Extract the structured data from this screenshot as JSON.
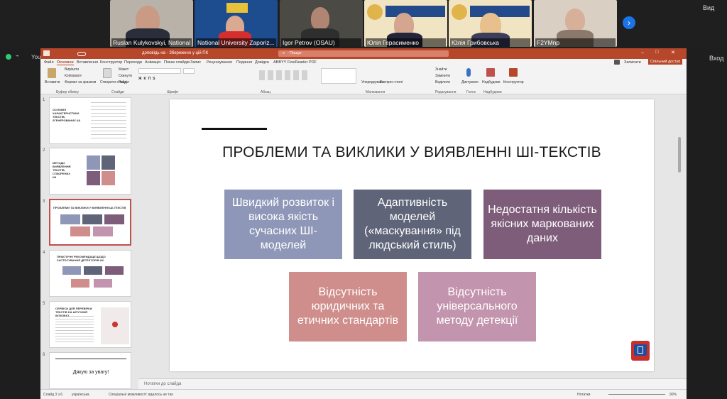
{
  "meeting": {
    "participants": [
      {
        "name": "Ruslan Kulykovskyi, National ..."
      },
      {
        "name": "National University Zaporiz..."
      },
      {
        "name": "Igor Petrov (OSAU)"
      },
      {
        "name": "Юлія Герасименко"
      },
      {
        "name": "Юлія Грибовська"
      },
      {
        "name": "F2YMnp"
      }
    ],
    "view_label": "Вид",
    "exit_label": "Вход",
    "youtube_label": "YouTube"
  },
  "ppt": {
    "filename": "доповідь на - Збережено у цій ПК",
    "search_placeholder": "Пошук",
    "tabs": [
      "Файл",
      "Основне",
      "Вставлення",
      "Конструктор",
      "Переходи",
      "Анімація",
      "Показ слайдів",
      "Запис",
      "Рецензування",
      "Подання",
      "Довідка",
      "ABBYY FineReader PDF"
    ],
    "record_label": "Записати",
    "share_label": "Спільний доступ",
    "ribbon_groups": [
      "Буфер обміну",
      "Слайди",
      "Шрифт",
      "Абзац",
      "Малювання",
      "Редагування",
      "Голос",
      "Надбудови"
    ],
    "ribbon_buttons": {
      "paste": "Вставити",
      "cut": "Вирізати",
      "copy": "Копіювати",
      "format_painter": "Формат за зразком",
      "new_slide": "Створити слайд",
      "layout": "Макет",
      "reset": "Скинути",
      "section": "Розділ",
      "arrange": "Упорядкувати",
      "quick_styles": "Експрес-стилі",
      "find": "Знайти",
      "replace": "Замінити",
      "select": "Виділити",
      "dictate": "Диктувати",
      "addins": "Надбудови",
      "designer": "Конструктор"
    },
    "notes_placeholder": "Нотатки до слайда",
    "status": {
      "slide_count": "Слайд 3 з 6",
      "language": "українська",
      "accessibility": "Спеціальні можливості: вдалось не так",
      "notes": "Нотатки",
      "zoom": "90%"
    }
  },
  "thumbnails": [
    {
      "number": "1",
      "title": "ОСНОВНІ ХАРАКТЕРИСТИКИ ТЕКСТІВ, ЗГЕНЕРОВАНИХ ШІ"
    },
    {
      "number": "2",
      "title": "МЕТОДИ ВИЯВЛЕННЯ ТЕКСТІВ, СТВОРЕНИХ ШІ"
    },
    {
      "number": "3",
      "title": "ПРОБЛЕМИ ТА ВИКЛИКИ У ВИЯВЛЕННІ ШІ-ТЕКСТІВ"
    },
    {
      "number": "4",
      "title": "ПРАКТИЧНІ РЕКОМЕНДАЦІЇ ЩОДО ЗАСТОСУВАННЯ ДЕТЕКТОРІВ ШІ"
    },
    {
      "number": "5",
      "title": "СЕРВІСИ ДЛЯ ПЕРЕВІРКИ ТЕКСТІВ НА ШТУЧНИЙ ІНТЕЛЕКТ"
    },
    {
      "number": "6",
      "title": "Дякую за увагу!"
    }
  ],
  "slide": {
    "title": "ПРОБЛЕМИ ТА ВИКЛИКИ У ВИЯВЛЕННІ ШІ-ТЕКСТІВ",
    "boxes": [
      {
        "text": "Швидкий розвиток і висока якість сучасних ШІ-моделей",
        "color": "#8e97b8"
      },
      {
        "text": "Адаптивність моделей («маскування» під людський стиль)",
        "color": "#5f6478"
      },
      {
        "text": "Недостатня кількість якісних маркованих даних",
        "color": "#7e5d7a"
      },
      {
        "text": "Відсутність юридичних та етичних стандартів",
        "color": "#cf8e8c"
      },
      {
        "text": "Відсутність універсального методу детекції",
        "color": "#c394ad"
      }
    ]
  }
}
